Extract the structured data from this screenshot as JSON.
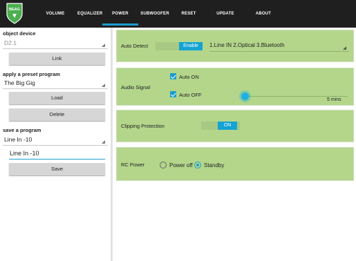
{
  "app": {
    "logo_text": "BEAG",
    "tabs": [
      {
        "label": "VOLUME",
        "active": false
      },
      {
        "label": "EQUALIZER",
        "active": false
      },
      {
        "label": "POWER",
        "active": true
      },
      {
        "label": "SUBWOOFER",
        "active": false
      },
      {
        "label": "RESET",
        "active": false
      },
      {
        "label": "UPDATE",
        "active": false
      },
      {
        "label": "ABOUT",
        "active": false
      }
    ],
    "accent_color": "#1a9dd0",
    "panel_color": "#b3d68b"
  },
  "left": {
    "object_device": {
      "label": "object device",
      "value": "D2.1",
      "link_label": "Link"
    },
    "preset": {
      "label": "apply a preset program",
      "value": "The Big Gig",
      "load_label": "Load",
      "delete_label": "Delete"
    },
    "save": {
      "label": "save a program",
      "spinner_value": "Line In -10",
      "input_value": "Line In -10",
      "save_label": "Save"
    }
  },
  "power": {
    "auto_detect": {
      "label": "Auto Detect",
      "toggle_label": "Enable",
      "source_value": "1.Line IN 2.Optical 3.Bluetooth"
    },
    "audio_signal": {
      "label": "Audio Signal",
      "auto_on_label": "Auto ON",
      "auto_on_checked": true,
      "auto_off_label": "Auto OFF",
      "auto_off_checked": true,
      "timer_value": "5 mins"
    },
    "clipping": {
      "label": "Clipping Protection",
      "toggle_label": "ON"
    },
    "rc_power": {
      "label": "RC Power",
      "options": [
        "Power off",
        "Standby"
      ],
      "selected": "Standby"
    }
  }
}
